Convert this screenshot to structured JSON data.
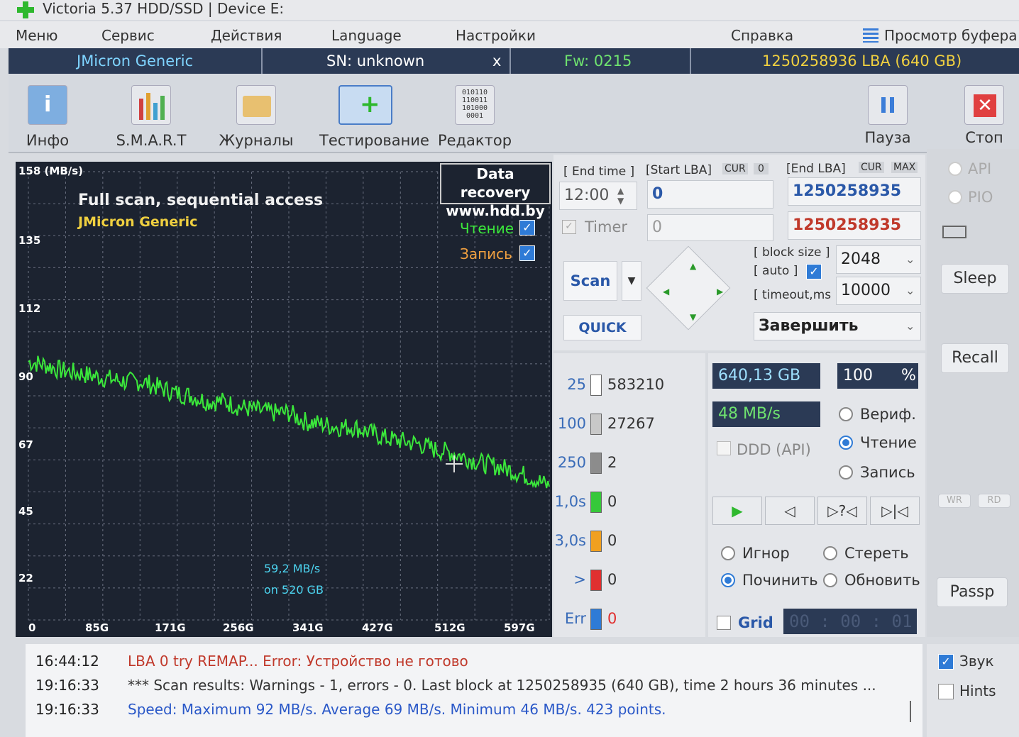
{
  "window": {
    "title": "Victoria 5.37 HDD/SSD | Device E:"
  },
  "menu": {
    "items": [
      "Меню",
      "Сервис",
      "Действия",
      "Language",
      "Настройки",
      "Справка"
    ],
    "buffer_view": "Просмотр буфера"
  },
  "device": {
    "model": "JMicron Generic",
    "serial": "SN: unknown",
    "close": "x",
    "firmware": "Fw: 0215",
    "capacity": "1250258936 LBA (640 GB)"
  },
  "toolbar": {
    "info": "Инфо",
    "smart": "S.M.A.R.T",
    "logs": "Журналы",
    "testing": "Тестирование",
    "editor": "Редактор",
    "pause": "Пауза",
    "stop": "Стоп"
  },
  "graph": {
    "y_unit": "158 (MB/s)",
    "y_ticks": [
      "135",
      "112",
      "90",
      "67",
      "45",
      "22"
    ],
    "x_ticks": [
      "0",
      "85G",
      "171G",
      "256G",
      "341G",
      "427G",
      "512G",
      "597G"
    ],
    "title": "Full scan, sequential access",
    "device": "JMicron Generic",
    "promo_line1": "Data recovery",
    "promo_line2": "www.hdd.by",
    "read_label": "Чтение",
    "write_label": "Запись",
    "cursor_speed": "59,2 MB/s",
    "cursor_pos": "on 520 GB"
  },
  "chart_data": {
    "type": "line",
    "ylim": [
      0,
      158
    ],
    "xlim": [
      0,
      640
    ],
    "x": [
      0,
      20,
      40,
      60,
      80,
      100,
      120,
      140,
      160,
      180,
      200,
      220,
      240,
      260,
      280,
      300,
      320,
      340,
      360,
      380,
      400,
      420,
      440,
      460,
      480,
      500,
      520,
      540,
      560,
      580,
      600,
      620,
      640
    ],
    "values": [
      91,
      90,
      88,
      87,
      86,
      85,
      84,
      84,
      82,
      80,
      79,
      77,
      77,
      75,
      74,
      73,
      73,
      70,
      69,
      68,
      68,
      66,
      64,
      63,
      62,
      60,
      59,
      57,
      55,
      54,
      52,
      50,
      47
    ]
  },
  "scan": {
    "end_time_label": "[ End time ]",
    "start_lba_label": "[Start LBA]",
    "cur": "CUR",
    "zero": "0",
    "end_lba_label": "[End LBA]",
    "max": "MAX",
    "end_time": "12:00",
    "start_lba": "0",
    "end_lba": "1250258935",
    "timer_label": "Timer",
    "timer_value": "0",
    "current_lba": "1250258935",
    "block_size_label": "[ block size ]",
    "auto_label": "[ auto ]",
    "timeout_label": "[ timeout,ms ]",
    "block_size": "2048",
    "timeout": "10000",
    "scan_button": "Scan",
    "quick_button": "QUICK",
    "finish_action": "Завершить"
  },
  "counters": [
    {
      "label": "25",
      "value": "583210",
      "color": "#ffffff"
    },
    {
      "label": "100",
      "value": "27267",
      "color": "#c8c8c8"
    },
    {
      "label": "250",
      "value": "2",
      "color": "#8c8c8c"
    },
    {
      "label": "1,0s",
      "value": "0",
      "color": "#36c83a"
    },
    {
      "label": "3,0s",
      "value": "0",
      "color": "#f0a020"
    },
    {
      "label": ">",
      "value": "0",
      "color": "#e03030"
    },
    {
      "label": "Err",
      "value": "0",
      "color": "#2f7bd6"
    }
  ],
  "status": {
    "processed": "640,13 GB",
    "percent": "100",
    "percent_sign": "%",
    "speed": "48 MB/s",
    "ddd": "DDD (API)",
    "mode_verify": "Вериф.",
    "mode_read": "Чтение",
    "mode_write": "Запись",
    "ignore": "Игнор",
    "erase": "Стереть",
    "repair": "Починить",
    "refresh": "Обновить",
    "grid": "Grid",
    "elapsed": "00 : 00 : 01"
  },
  "sidebar": {
    "api": "API",
    "pio": "PIO",
    "sleep": "Sleep",
    "recall": "Recall",
    "wr": "WR",
    "rd": "RD",
    "passp": "Passp",
    "sound": "Звук",
    "hints": "Hints"
  },
  "log": [
    {
      "time": "16:44:12",
      "text": "LBA 0 try REMAP... Error: Устройство не готово",
      "color": "#c0392b"
    },
    {
      "time": "19:16:33",
      "text": "*** Scan results: Warnings - 1, errors - 0. Last block at 1250258935 (640 GB), time 2 hours 36 minutes ...",
      "color": "#333333"
    },
    {
      "time": "19:16:33",
      "text": "Speed: Maximum 92 MB/s. Average 69 MB/s. Minimum 46 MB/s. 423 points.",
      "color": "#2a58c8"
    }
  ]
}
